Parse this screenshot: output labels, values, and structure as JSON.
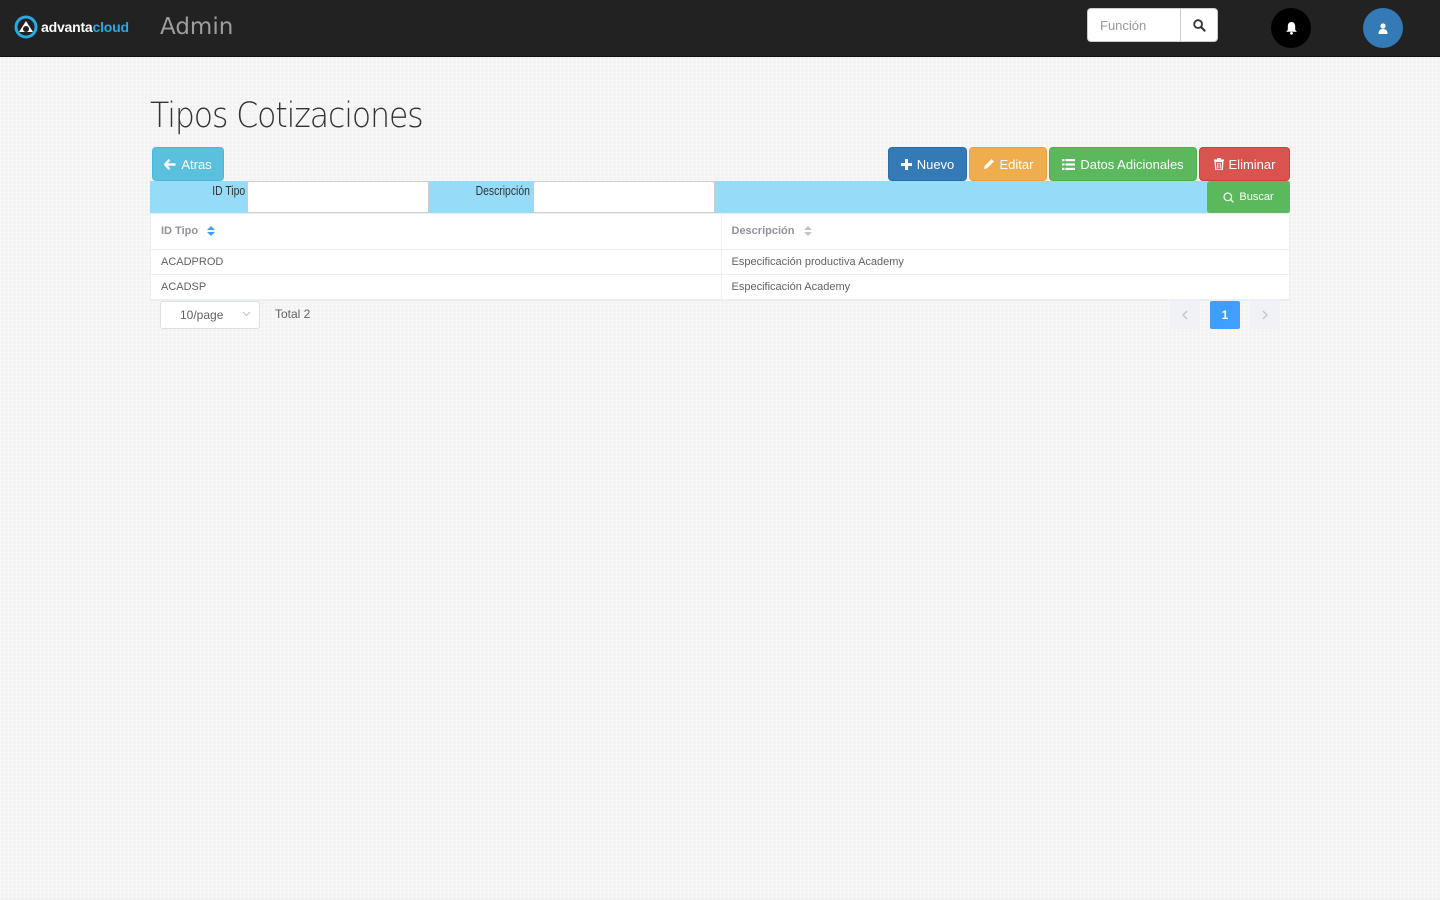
{
  "navbar": {
    "brand_part1": "advanta",
    "brand_part2": "cloud",
    "title": "Admin",
    "search_placeholder": "Función"
  },
  "page": {
    "title": "Tipos Cotizaciones"
  },
  "toolbar": {
    "back_label": "Atras",
    "new_label": "Nuevo",
    "edit_label": "Editar",
    "extra_label": "Datos Adicionales",
    "delete_label": "Eliminar"
  },
  "filters": {
    "id_label": "ID Tipo",
    "desc_label": "Descripción",
    "id_value": "",
    "desc_value": "",
    "search_label": "Buscar"
  },
  "table": {
    "columns": [
      "ID Tipo",
      "Descripción"
    ],
    "rows": [
      [
        "ACADPROD",
        "Especificación productiva Academy"
      ],
      [
        "ACADSP",
        "Especificación Academy"
      ]
    ]
  },
  "pagination": {
    "page_size": "10/page",
    "total": "Total 2",
    "current_page": "1"
  },
  "colors": {
    "navbar": "#222222",
    "filter_bar": "#96dcf8",
    "primary": "#337ab7",
    "warning": "#f0ad4e",
    "success": "#5cb85c",
    "danger": "#d9534f",
    "info": "#5bc0de",
    "pager_active": "#409eff"
  }
}
